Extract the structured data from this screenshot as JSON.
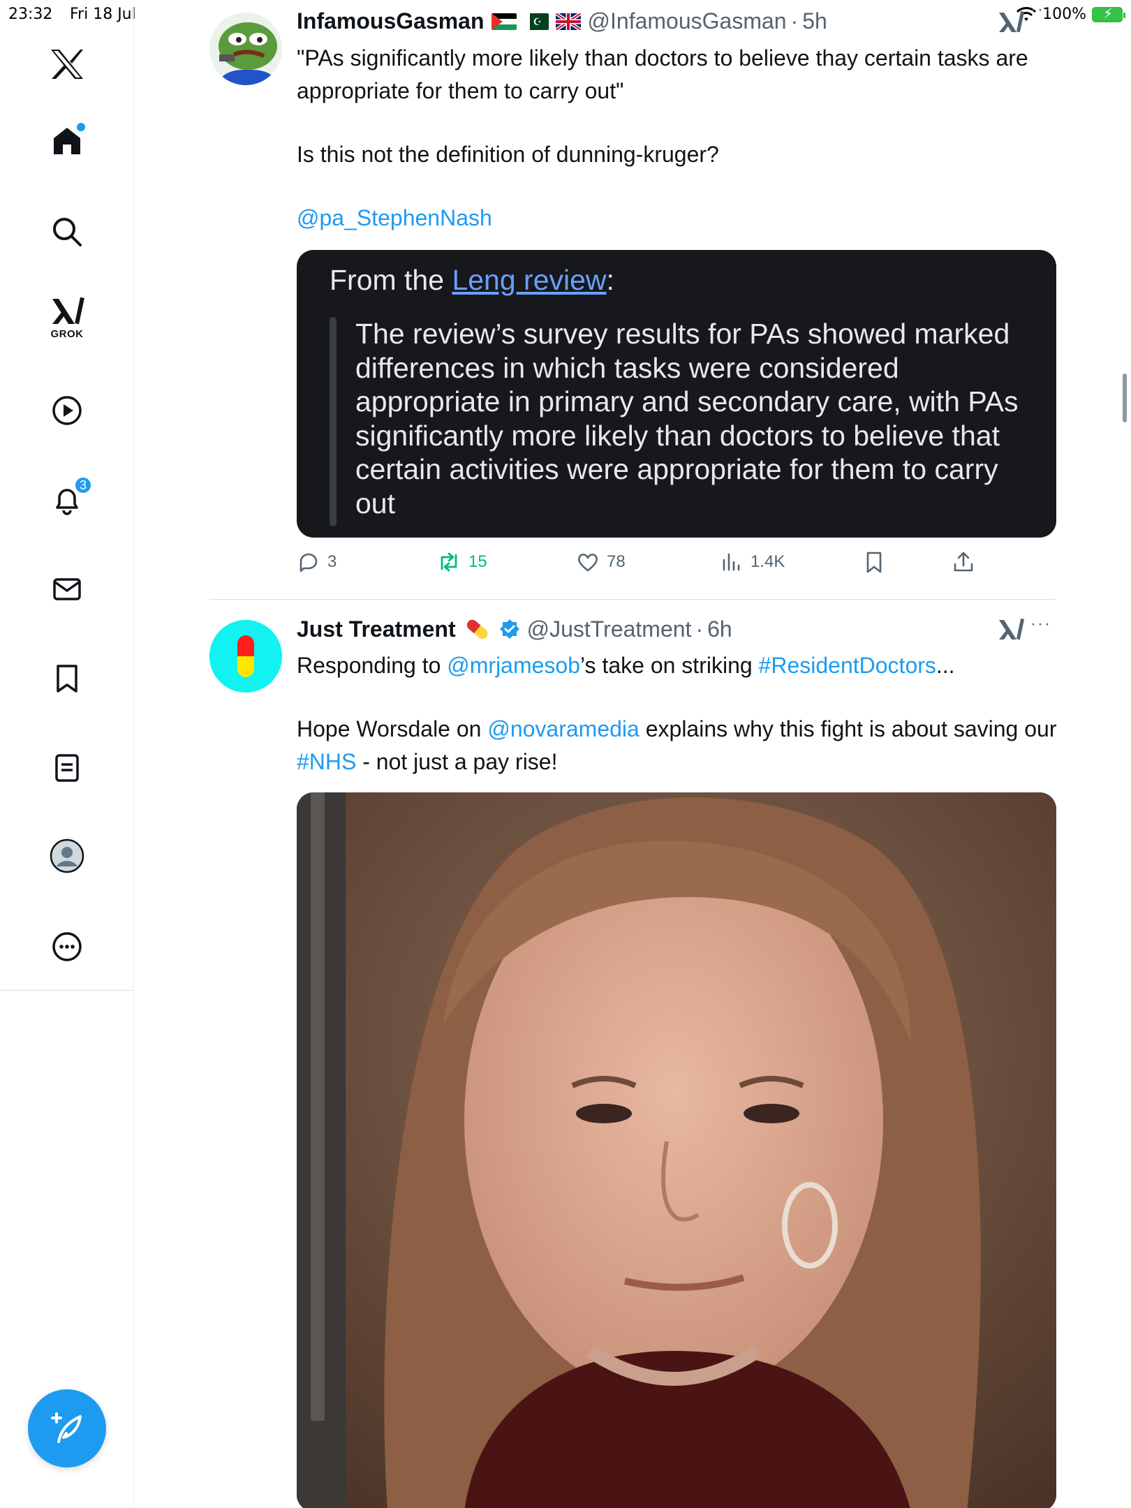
{
  "status_bar": {
    "time": "23:32",
    "date": "Fri 18 Jul",
    "battery": "100%"
  },
  "sidebar": {
    "items": [
      {
        "name": "logo",
        "icon": "x-logo-icon"
      },
      {
        "name": "home",
        "icon": "home-icon"
      },
      {
        "name": "explore",
        "icon": "search-icon"
      },
      {
        "name": "grok",
        "icon": "grok-icon",
        "label": "GROK"
      },
      {
        "name": "videos",
        "icon": "play-icon"
      },
      {
        "name": "notifications",
        "icon": "bell-icon",
        "badge": "3"
      },
      {
        "name": "messages",
        "icon": "mail-icon"
      },
      {
        "name": "bookmarks",
        "icon": "bookmark-icon"
      },
      {
        "name": "lists",
        "icon": "list-icon"
      },
      {
        "name": "profile",
        "icon": "avatar-icon"
      },
      {
        "name": "more",
        "icon": "more-circle-icon"
      }
    ],
    "compose_icon": "compose-icon"
  },
  "tweets": [
    {
      "display_name": "InfamousGasman",
      "handle": "@InfamousGasman",
      "time": "5h",
      "text_1": "\"PAs significantly more likely than doctors to believe thay certain tasks are appropriate for them to carry out\"",
      "text_2": "Is this not the definition of dunning-kruger?",
      "mention": "@pa_StephenNash",
      "quote": {
        "intro_prefix": "From the ",
        "intro_link": "Leng review",
        "intro_suffix": ":",
        "body": "The review’s survey results for PAs showed marked differences in which tasks were considered appropriate in primary and secondary care, with PAs significantly more likely than doctors to believe that certain activities were appropriate for them to carry out"
      },
      "replies": "3",
      "reposts": "15",
      "likes": "78",
      "views": "1.4K"
    },
    {
      "display_name": "Just Treatment",
      "handle": "@JustTreatment",
      "time": "6h",
      "line1_a": "Responding to ",
      "line1_mention": "@mrjamesob",
      "line1_b": "’s take on striking ",
      "line1_hashtag": "#ResidentDoctors",
      "line1_ellipsis": "...",
      "line2_a": "Hope Worsdale on ",
      "line2_mention": "@novaramedia",
      "line2_b": "  explains why this fight is about saving our ",
      "line2_hashtag": "#NHS",
      "line2_c": " - not just a pay rise!"
    }
  ],
  "colors": {
    "accent": "#1d9bf0",
    "repost": "#00ba7c",
    "muted": "#536471"
  }
}
